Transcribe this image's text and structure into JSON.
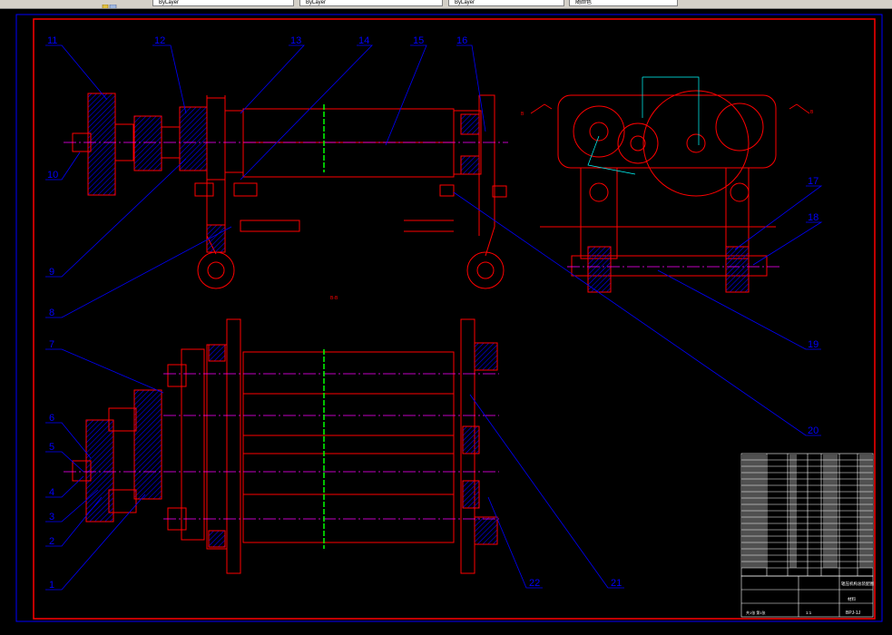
{
  "toolbar": {
    "fields": [
      "ByLayer",
      "ByLayer",
      "ByLayer",
      "随颜色"
    ]
  },
  "drawing": {
    "callouts": [
      "1",
      "2",
      "3",
      "4",
      "5",
      "6",
      "7",
      "8",
      "9",
      "10",
      "11",
      "12",
      "13",
      "14",
      "15",
      "16",
      "17",
      "18",
      "19",
      "20",
      "21",
      "22"
    ],
    "section_labels": {
      "section_top": "B-B",
      "side_left": "B",
      "side_right": "B"
    },
    "title_block": {
      "title": "辊压机构总装配图",
      "material": "材料",
      "drawing_no": "BPJ-1J",
      "scale": "1:1",
      "sheet": "共1张 第1张"
    }
  },
  "colors": {
    "background": "#000000",
    "frame": "#ff0000",
    "outer_frame": "#0000ff",
    "leader": "#0000ff",
    "center_line": "#ff00ff",
    "axis_mark": "#00ff00",
    "hatch": "#0000ff",
    "dimension": "#00ffff",
    "table_lines": "#ffffff"
  }
}
